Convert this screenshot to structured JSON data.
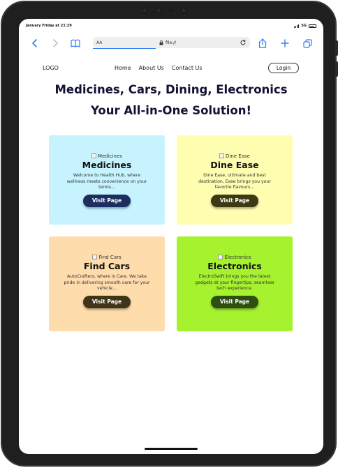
{
  "status_bar": {
    "time": "January Friday at 21:29",
    "network": "5G"
  },
  "browser": {
    "text_size_label": "AA",
    "address": "file://"
  },
  "site": {
    "logo": "LOGO",
    "nav": [
      "Home",
      "About Us",
      "Contact Us"
    ],
    "login_label": "Login",
    "headline_1": "Medicines, Cars, Dining, Electronics",
    "headline_2": "Your All-in-One Solution!"
  },
  "cards": [
    {
      "img_alt": "Medicines",
      "title": "Medicines",
      "description": "Welcome to Health Hub, where wellness meets convenience on your terms...",
      "button": "Visit Page",
      "bg": "#c6f3fe",
      "button_color": "#1b2e5f"
    },
    {
      "img_alt": "Dine Ease",
      "title": "Dine Ease",
      "description": "Dine Ease, ultimate and best destination, Ease brings you your favorite flavours...",
      "button": "Visit Page",
      "bg": "#fefdb0",
      "button_color": "#3d3a13"
    },
    {
      "img_alt": "Find Cars",
      "title": "Find Cars",
      "description": "AutoCrafters, where is Care. We take pride in delivering smooth care for your vehicle...",
      "button": "Visit Page",
      "bg": "#fedcab",
      "button_color": "#3f3518"
    },
    {
      "img_alt": "Electronics",
      "title": "Electronics",
      "description": "ElectroSwift brings you the latest gadgets at your fingertips, seamless tech experience.",
      "button": "Visit Page",
      "bg": "#a6f22f",
      "button_color": "#2e4f10"
    }
  ]
}
